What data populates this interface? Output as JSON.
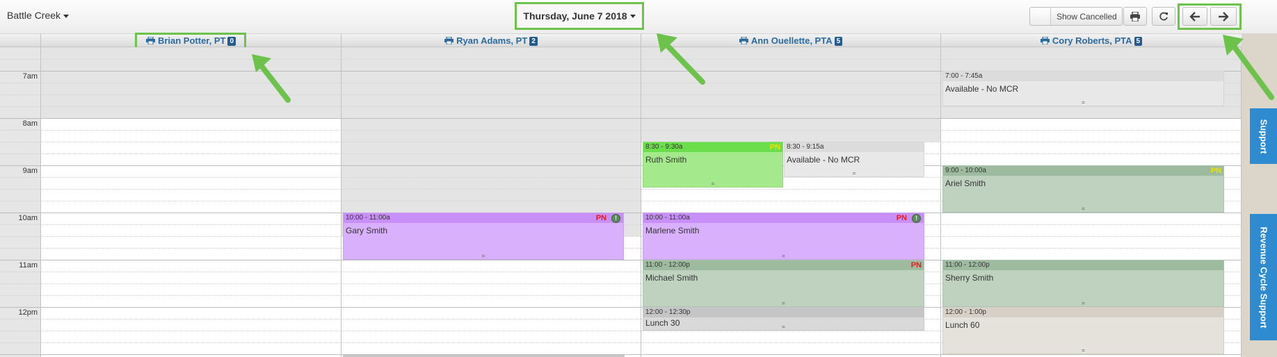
{
  "toolbar": {
    "location": "Battle Creek",
    "date": "Thursday, June 7 2018",
    "show_cancelled_label": "Show Cancelled"
  },
  "icons": {
    "location_caret": "chevron-down-icon",
    "date_caret": "chevron-down-icon",
    "print": "printer-icon",
    "refresh": "refresh-icon",
    "prev": "arrow-left-icon",
    "next": "arrow-right-icon",
    "column_print": "printer-icon"
  },
  "colors": {
    "highlight": "#6dc24b",
    "header_text": "#2a6a9e",
    "count_badge": "#225b8c",
    "side_tab": "#2e8bcf",
    "pn_red": "#e51b1b",
    "pn_yellow": "#e8e400"
  },
  "providers": [
    {
      "name": "Brian Potter, PT",
      "count": "0"
    },
    {
      "name": "Ryan Adams, PT",
      "count": "2"
    },
    {
      "name": "Ann Ouellette, PTA",
      "count": "5"
    },
    {
      "name": "Cory Roberts, PTA",
      "count": "5"
    }
  ],
  "times": [
    "7am",
    "8am",
    "9am",
    "10am",
    "11am",
    "12pm"
  ],
  "appointments": {
    "ryan_1": {
      "time": "10:00 - 11:00a",
      "name": "Gary Smith",
      "flag": "PN",
      "color": "#d8b0fb"
    },
    "ann_1": {
      "time": "8:30 - 9:30a",
      "name": "Ruth Smith",
      "flag": "PN",
      "color": "#a4e98c"
    },
    "ann_2": {
      "time": "8:30 - 9:15a",
      "name": "Available - No MCR",
      "color": "#e8e8e8"
    },
    "ann_3": {
      "time": "10:00 - 11:00a",
      "name": "Marlene Smith",
      "flag": "PN",
      "color": "#d8b0fb"
    },
    "ann_4": {
      "time": "11:00 - 12:00p",
      "name": "Michael Smith",
      "flag": "PN",
      "color": "#bed2bf"
    },
    "ann_5": {
      "time": "12:00 - 12:30p",
      "name": "Lunch 30",
      "color": "#d9d9d9"
    },
    "cory_1": {
      "time": "7:00 - 7:45a",
      "name": "Available - No MCR",
      "color": "#e8e8e8"
    },
    "cory_2": {
      "time": "9:00 - 10:00a",
      "name": "Ariel Smith",
      "flag": "PN",
      "color": "#bed2bf"
    },
    "cory_3": {
      "time": "11:00 - 12:00p",
      "name": "Sherry Smith",
      "color": "#bed2bf"
    },
    "cory_4": {
      "time": "12:00 - 1:00p",
      "name": "Lunch 60",
      "color": "#e5e1db"
    }
  },
  "side_tabs": {
    "support": "Support",
    "revenue": "Revenue Cycle Support"
  }
}
